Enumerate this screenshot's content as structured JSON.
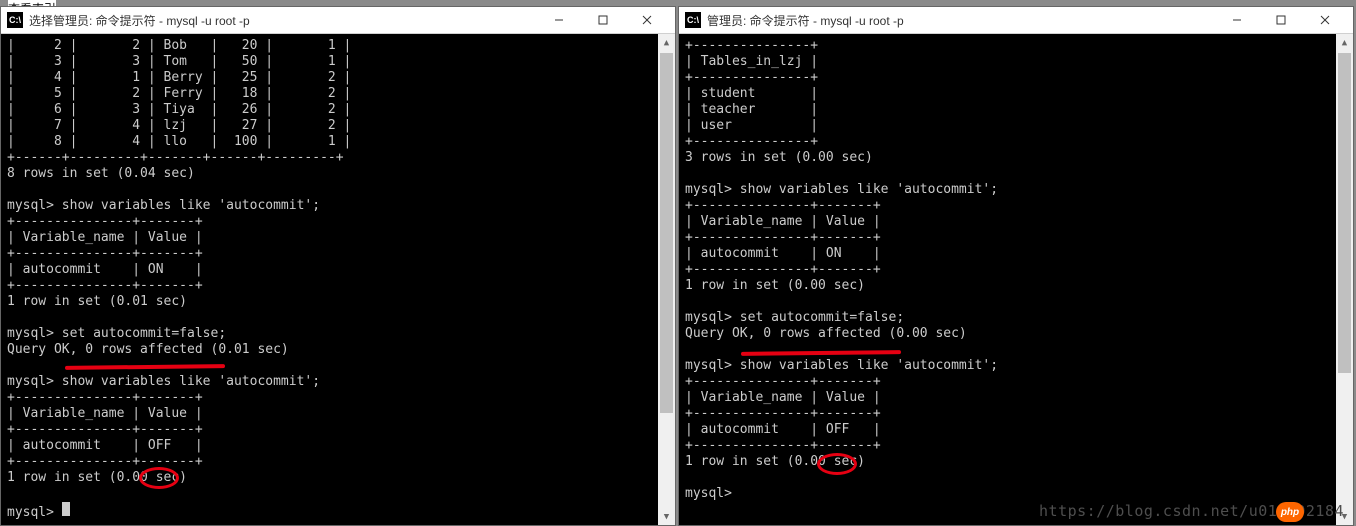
{
  "top_fragment_text": "     查看索引",
  "left": {
    "title": "选择管理员: 命令提示符 - mysql  -u root -p",
    "app_icon_text": "C:\\",
    "table_rows": [
      [
        "2",
        "2",
        "Bob",
        "20",
        "1"
      ],
      [
        "3",
        "3",
        "Tom",
        "50",
        "1"
      ],
      [
        "4",
        "1",
        "Berry",
        "25",
        "2"
      ],
      [
        "5",
        "2",
        "Ferry",
        "18",
        "2"
      ],
      [
        "6",
        "3",
        "Tiya",
        "26",
        "2"
      ],
      [
        "7",
        "4",
        "lzj",
        "27",
        "2"
      ],
      [
        "8",
        "4",
        "llo",
        "100",
        "1"
      ]
    ],
    "table_border": "+------+---------+-------+------+---------+",
    "rows_in_set": "8 rows in set (0.04 sec)",
    "prompt": "mysql>",
    "cmd1": "show variables like 'autocommit';",
    "var_border": "+---------------+-------+",
    "var_header": "| Variable_name | Value |",
    "var_row_on": "| autocommit    | ON    |",
    "var_row_off": "| autocommit    | OFF   |",
    "one_row_01": "1 row in set (0.01 sec)",
    "one_row_00": "1 row in set (0.00 sec)",
    "cmd2": "set autocommit=false;",
    "query_ok": "Query OK, 0 rows affected (0.01 sec)",
    "cmd3": "show variables like 'autocommit';"
  },
  "right": {
    "title": "管理员: 命令提示符 - mysql  -u root -p",
    "app_icon_text": "C:\\",
    "tbl_border": "+---------------+",
    "tbl_header": "| Tables_in_lzj |",
    "tbl_rows": [
      "student",
      "teacher",
      "user"
    ],
    "rows_in_set": "3 rows in set (0.00 sec)",
    "prompt": "mysql>",
    "cmd1": "show variables like 'autocommit';",
    "var_border": "+---------------+-------+",
    "var_header": "| Variable_name | Value |",
    "var_row_on": "| autocommit    | ON    |",
    "var_row_off": "| autocommit    | OFF   |",
    "one_row_00": "1 row in set (0.00 sec)",
    "cmd2": "set autocommit=false;",
    "query_ok": "Query OK, 0 rows affected (0.00 sec)",
    "cmd3": "show variables like 'autocommit';"
  },
  "watermark": "https://blog.csdn.net/u010002184",
  "php_badge": "php"
}
